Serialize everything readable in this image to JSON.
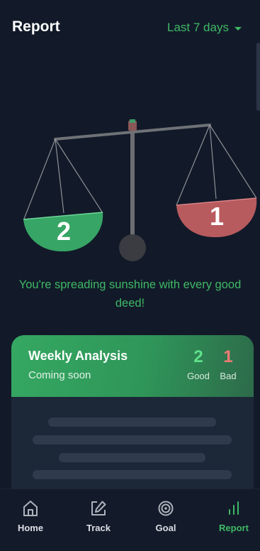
{
  "header": {
    "title": "Report",
    "period_label": "Last 7 days"
  },
  "scale": {
    "good_count": "2",
    "bad_count": "1"
  },
  "message": "You're spreading sunshine with every good deed!",
  "analysis_card": {
    "title": "Weekly Analysis",
    "subtitle": "Coming soon",
    "good_value": "2",
    "good_label": "Good",
    "bad_value": "1",
    "bad_label": "Bad"
  },
  "nav": {
    "items": [
      {
        "label": "Home",
        "icon": "home-icon"
      },
      {
        "label": "Track",
        "icon": "edit-icon"
      },
      {
        "label": "Goal",
        "icon": "target-icon"
      },
      {
        "label": "Report",
        "icon": "bar-chart-icon"
      }
    ],
    "active": "Report"
  },
  "colors": {
    "background": "#121a29",
    "accent_green": "#3fb865",
    "good_pan": "#37a565",
    "bad_pan": "#b85b5e",
    "card": "#1c2738"
  }
}
